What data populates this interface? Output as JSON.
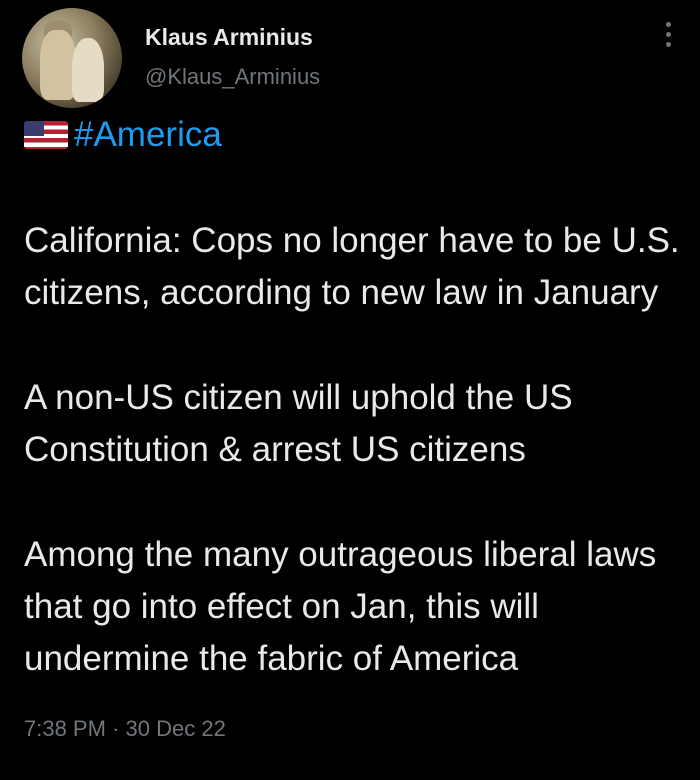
{
  "author": {
    "name": "Klaus Arminius",
    "handle": "@Klaus_Arminius"
  },
  "hashtag": "#America",
  "paragraphs": [
    "California: Cops no longer have to be U.S. citizens, according to new law in January",
    "A non-US citizen will uphold the US Constitution & arrest US citizens",
    "Among the many outrageous liberal laws that go into effect on Jan, this will undermine the fabric of America"
  ],
  "meta": {
    "time": "7:38 PM",
    "separator": "·",
    "date": "30 Dec 22"
  },
  "colors": {
    "background": "#000000",
    "text": "#e7e9ea",
    "secondary": "#71767b",
    "link": "#1d9bf0"
  },
  "icons": [
    "us-flag-icon",
    "more-options-icon"
  ]
}
